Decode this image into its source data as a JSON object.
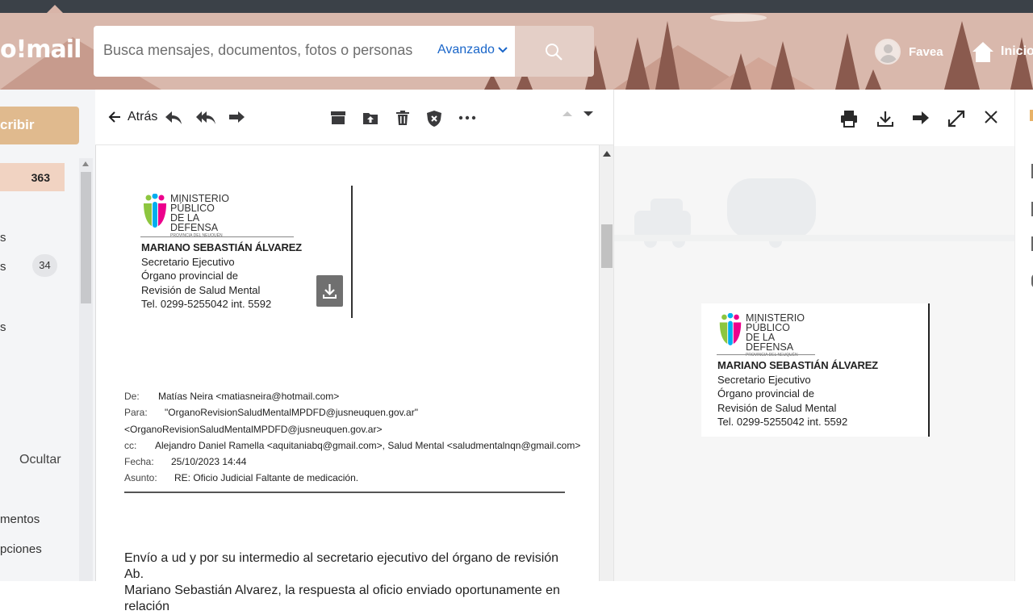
{
  "app": {
    "logo": "o!mail"
  },
  "search": {
    "placeholder": "Busca mensajes, documentos, fotos o personas",
    "advanced_label": "Avanzado"
  },
  "user": {
    "name": "Favea",
    "home_label": "Inicio"
  },
  "sidebar": {
    "compose_label": "cribir",
    "inbox_count": "363",
    "items": [
      {
        "label": "s"
      },
      {
        "label": "s",
        "badge": "34"
      },
      {
        "label": "s"
      }
    ],
    "hide_label": "Ocultar",
    "bottom_items": [
      {
        "label": "mentos"
      },
      {
        "label": "pciones"
      }
    ]
  },
  "toolbar": {
    "back_label": "Atrás"
  },
  "signature": {
    "org_line1": "MINISTERIO",
    "org_line2": "PÚBLICO",
    "org_line3": "DE LA DEFENSA",
    "org_line4": "PROVINCIA DEL NEUQUÉN",
    "name": "MARIANO SEBASTIÁN ÁLVAREZ",
    "role": "Secretario Ejecutivo",
    "org_a": "Órgano provincial de",
    "org_b": "Revisión de Salud Mental",
    "phone": "Tel. 0299-5255042 int. 5592"
  },
  "email_meta": {
    "from_label": "De:",
    "from_value": "Matías Neira <matiasneira@hotmail.com>",
    "to_label": "Para:",
    "to_value": "\"OrganoRevisionSaludMentalMPDFD@jusneuquen.gov.ar\"",
    "to_value2": "<OrganoRevisionSaludMentalMPDFD@jusneuquen.gov.ar>",
    "cc_label": "cc:",
    "cc_value": "Alejandro Daniel Ramella <aquitaniabq@gmail.com>, Salud Mental <saludmentalnqn@gmail.com>",
    "date_label": "Fecha:",
    "date_value": "25/10/2023 14:44",
    "subject_label": "Asunto:",
    "subject_value": "RE: Oficio Judicial Faltante de medicación."
  },
  "body": {
    "line1": "Envío a ud y por su intermedio al secretario ejecutivo del órgano de revisión Ab.",
    "line2": "Mariano Sebastián Alvarez, la respuesta al oficio enviado oportunamente en relación"
  },
  "colors": {
    "header_bg": "#d9b8ac",
    "accent_blue": "#1a66c9",
    "compose_bg": "#e0ba8e",
    "inbox_highlight": "#f1d3c2"
  }
}
